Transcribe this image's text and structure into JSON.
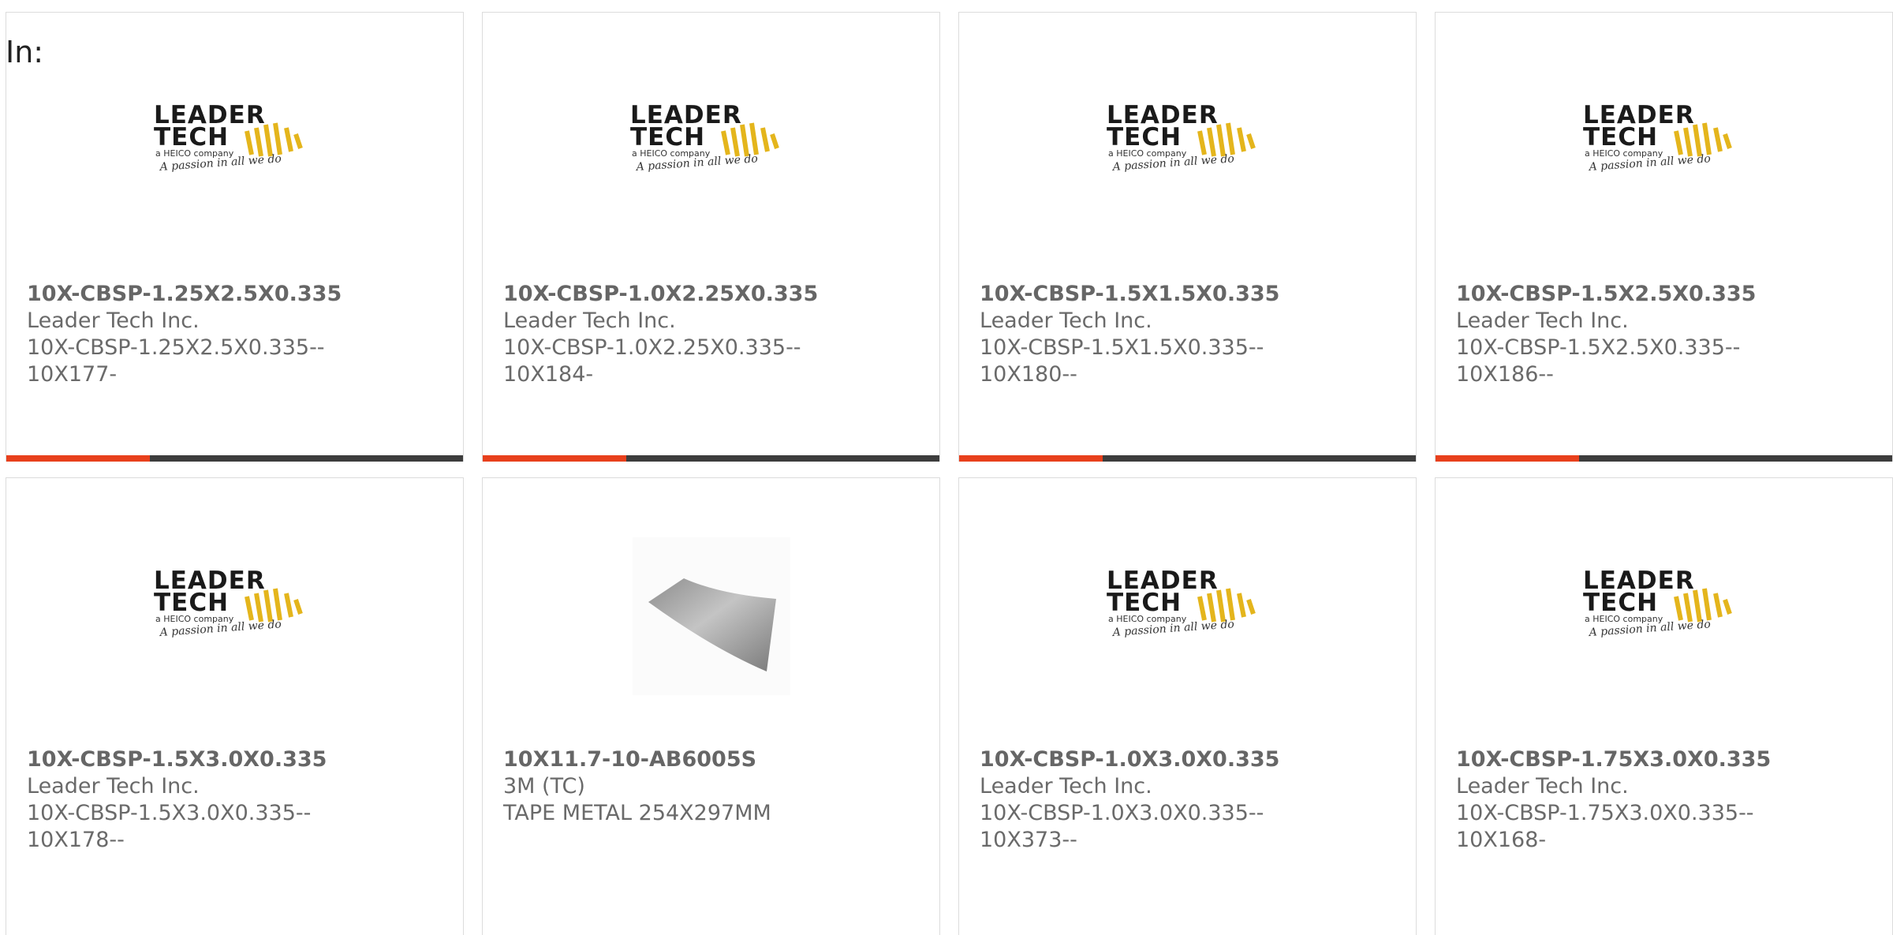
{
  "page_label": "In:",
  "logo": {
    "line1": "LEADER",
    "line2": "TECH",
    "sub": "a HEICO company",
    "tagline": "A passion in all we do"
  },
  "colors": {
    "accent": "#e8401c",
    "bar": "#3d3d3d",
    "text": "#6a6a6a",
    "logo_yellow": "#e4b51c"
  },
  "products": [
    {
      "title": "10X-CBSP-1.25X2.5X0.335",
      "maker": "Leader Tech Inc.",
      "desc_line1": "10X-CBSP-1.25X2.5X0.335--",
      "desc_line2": "10X177-",
      "image": "leader-tech-logo"
    },
    {
      "title": "10X-CBSP-1.0X2.25X0.335",
      "maker": "Leader Tech Inc.",
      "desc_line1": "10X-CBSP-1.0X2.25X0.335--",
      "desc_line2": "10X184-",
      "image": "leader-tech-logo"
    },
    {
      "title": "10X-CBSP-1.5X1.5X0.335",
      "maker": "Leader Tech Inc.",
      "desc_line1": "10X-CBSP-1.5X1.5X0.335--",
      "desc_line2": "10X180--",
      "image": "leader-tech-logo"
    },
    {
      "title": "10X-CBSP-1.5X2.5X0.335",
      "maker": "Leader Tech Inc.",
      "desc_line1": "10X-CBSP-1.5X2.5X0.335--",
      "desc_line2": "10X186--",
      "image": "leader-tech-logo"
    },
    {
      "title": "10X-CBSP-1.5X3.0X0.335",
      "maker": "Leader Tech Inc.",
      "desc_line1": "10X-CBSP-1.5X3.0X0.335--",
      "desc_line2": "10X178--",
      "image": "leader-tech-logo"
    },
    {
      "title": "10X11.7-10-AB6005S",
      "maker": "3M (TC)",
      "desc_line1": "TAPE METAL 254X297MM",
      "desc_line2": "",
      "image": "metal-tape-sheet"
    },
    {
      "title": "10X-CBSP-1.0X3.0X0.335",
      "maker": "Leader Tech Inc.",
      "desc_line1": "10X-CBSP-1.0X3.0X0.335--",
      "desc_line2": "10X373--",
      "image": "leader-tech-logo"
    },
    {
      "title": "10X-CBSP-1.75X3.0X0.335",
      "maker": "Leader Tech Inc.",
      "desc_line1": "10X-CBSP-1.75X3.0X0.335--",
      "desc_line2": "10X168-",
      "image": "leader-tech-logo"
    }
  ]
}
